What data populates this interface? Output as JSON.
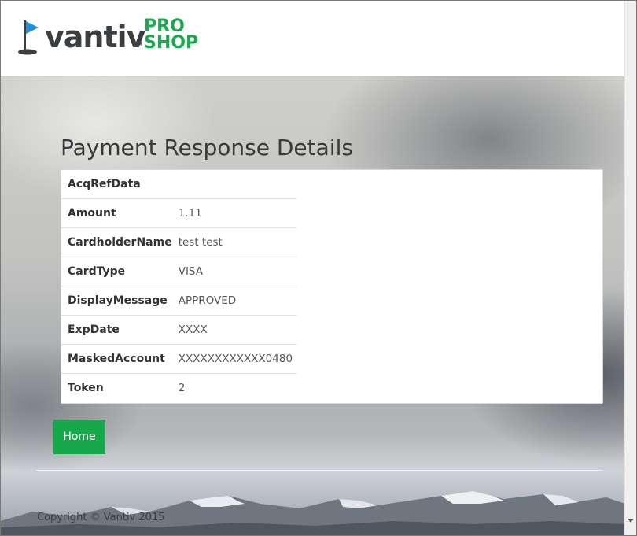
{
  "brand": {
    "logo_text": "vantiv",
    "logo_tm": "TM",
    "logo_pro": "PRO",
    "logo_shop": "SHOP",
    "colors": {
      "flag": "#1f8fe0",
      "text": "#3b3f42",
      "accent": "#1aaa4d"
    }
  },
  "main": {
    "title": "Payment Response Details",
    "rows": [
      {
        "key": "AcqRefData",
        "value": ""
      },
      {
        "key": "Amount",
        "value": "1.11"
      },
      {
        "key": "CardholderName",
        "value": "test test"
      },
      {
        "key": "CardType",
        "value": "VISA"
      },
      {
        "key": "DisplayMessage",
        "value": "APPROVED"
      },
      {
        "key": "ExpDate",
        "value": "XXXX"
      },
      {
        "key": "MaskedAccount",
        "value": "XXXXXXXXXXXX0480"
      },
      {
        "key": "Token",
        "value": "2"
      }
    ],
    "home_button": "Home"
  },
  "footer": {
    "copyright": "Copyright © Vantiv 2015"
  }
}
